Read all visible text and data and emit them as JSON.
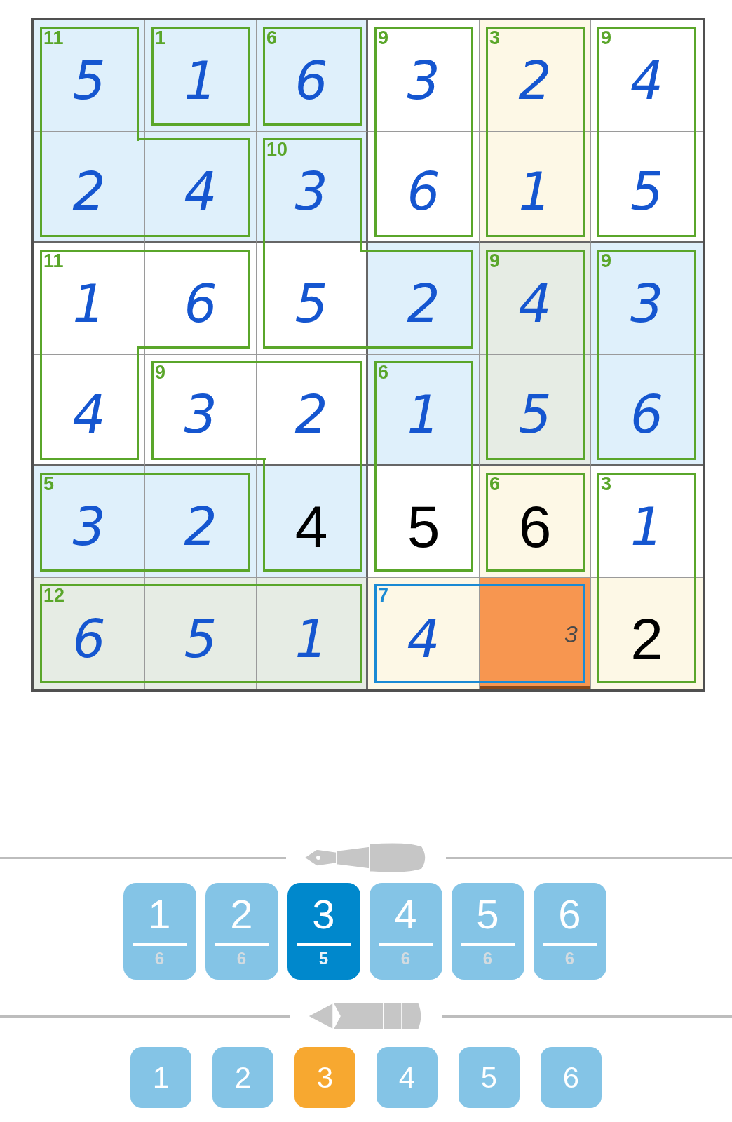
{
  "grid": {
    "rows": [
      [
        {
          "value": "5",
          "given": false,
          "selected": false,
          "color": "#dff0fb",
          "cage_sum": "11",
          "cage_selected": false,
          "joined_right": false,
          "joined_down": true
        },
        {
          "value": "1",
          "given": false,
          "selected": false,
          "color": "#dff0fb",
          "cage_sum": "1",
          "cage_selected": false,
          "joined_right": false,
          "joined_down": false
        },
        {
          "value": "6",
          "given": false,
          "selected": false,
          "color": "#dff0fb",
          "cage_sum": "6",
          "cage_selected": false,
          "joined_right": false,
          "joined_down": false
        },
        {
          "value": "3",
          "given": false,
          "selected": false,
          "color": "#ffffff",
          "cage_sum": "9",
          "cage_selected": false,
          "joined_right": false,
          "joined_down": true
        },
        {
          "value": "2",
          "given": false,
          "selected": false,
          "color": "#fdf8e6",
          "cage_sum": "3",
          "cage_selected": false,
          "joined_right": false,
          "joined_down": true
        },
        {
          "value": "4",
          "given": false,
          "selected": false,
          "color": "#ffffff",
          "cage_sum": "9",
          "cage_selected": false,
          "joined_right": false,
          "joined_down": true
        }
      ],
      [
        {
          "value": "2",
          "given": false,
          "selected": false,
          "color": "#dff0fb",
          "cage_selected": false,
          "joined_right": true,
          "joined_down": false
        },
        {
          "value": "4",
          "given": false,
          "selected": false,
          "color": "#dff0fb",
          "cage_selected": false,
          "joined_right": false,
          "joined_down": false
        },
        {
          "value": "3",
          "given": false,
          "selected": false,
          "color": "#dff0fb",
          "cage_sum": "10",
          "cage_selected": false,
          "joined_right": false,
          "joined_down": true
        },
        {
          "value": "6",
          "given": false,
          "selected": false,
          "color": "#ffffff",
          "cage_selected": false,
          "joined_right": false,
          "joined_down": false
        },
        {
          "value": "1",
          "given": false,
          "selected": false,
          "color": "#fdf8e6",
          "cage_selected": false,
          "joined_right": false,
          "joined_down": false
        },
        {
          "value": "5",
          "given": false,
          "selected": false,
          "color": "#ffffff",
          "cage_selected": false,
          "joined_right": false,
          "joined_down": false
        }
      ],
      [
        {
          "value": "1",
          "given": false,
          "selected": false,
          "color": "#ffffff",
          "cage_sum": "11",
          "cage_selected": false,
          "joined_right": true,
          "joined_down": true
        },
        {
          "value": "6",
          "given": false,
          "selected": false,
          "color": "#ffffff",
          "cage_selected": false,
          "joined_right": false,
          "joined_down": false
        },
        {
          "value": "5",
          "given": false,
          "selected": false,
          "color": "#ffffff",
          "cage_selected": false,
          "joined_right": true,
          "joined_down": false
        },
        {
          "value": "2",
          "given": false,
          "selected": false,
          "color": "#dff0fb",
          "cage_selected": false,
          "joined_right": false,
          "joined_down": false
        },
        {
          "value": "4",
          "given": false,
          "selected": false,
          "color": "#e6ece4",
          "cage_sum": "9",
          "cage_selected": false,
          "joined_right": false,
          "joined_down": true
        },
        {
          "value": "3",
          "given": false,
          "selected": false,
          "color": "#dff0fb",
          "cage_sum": "9",
          "cage_selected": false,
          "joined_right": false,
          "joined_down": true
        }
      ],
      [
        {
          "value": "4",
          "given": false,
          "selected": false,
          "color": "#ffffff",
          "cage_selected": false,
          "joined_right": false,
          "joined_down": false
        },
        {
          "value": "3",
          "given": false,
          "selected": false,
          "color": "#ffffff",
          "cage_sum": "9",
          "cage_selected": false,
          "joined_right": true,
          "joined_down": false
        },
        {
          "value": "2",
          "given": false,
          "selected": false,
          "color": "#ffffff",
          "cage_selected": false,
          "joined_right": false,
          "joined_down": true
        },
        {
          "value": "1",
          "given": false,
          "selected": false,
          "color": "#dff0fb",
          "cage_sum": "6",
          "cage_selected": false,
          "joined_right": false,
          "joined_down": true
        },
        {
          "value": "5",
          "given": false,
          "selected": false,
          "color": "#e6ece4",
          "cage_selected": false,
          "joined_right": false,
          "joined_down": false
        },
        {
          "value": "6",
          "given": false,
          "selected": false,
          "color": "#dff0fb",
          "cage_selected": false,
          "joined_right": false,
          "joined_down": false
        }
      ],
      [
        {
          "value": "3",
          "given": false,
          "selected": false,
          "color": "#dff0fb",
          "cage_sum": "5",
          "cage_selected": false,
          "joined_right": true,
          "joined_down": false
        },
        {
          "value": "2",
          "given": false,
          "selected": false,
          "color": "#dff0fb",
          "cage_selected": false,
          "joined_right": false,
          "joined_down": false
        },
        {
          "value": "4",
          "given": true,
          "selected": false,
          "color": "#dff0fb",
          "cage_selected": false,
          "joined_right": false,
          "joined_down": false
        },
        {
          "value": "5",
          "given": true,
          "selected": false,
          "color": "#ffffff",
          "cage_selected": false,
          "joined_right": false,
          "joined_down": false
        },
        {
          "value": "6",
          "given": true,
          "selected": false,
          "color": "#fdf8e6",
          "cage_sum": "6",
          "cage_selected": false,
          "joined_right": false,
          "joined_down": false
        },
        {
          "value": "1",
          "given": false,
          "selected": false,
          "color": "#ffffff",
          "cage_sum": "3",
          "cage_selected": false,
          "joined_right": false,
          "joined_down": true
        }
      ],
      [
        {
          "value": "6",
          "given": false,
          "selected": false,
          "color": "#e6ece4",
          "cage_sum": "12",
          "cage_selected": false,
          "joined_right": true,
          "joined_down": false
        },
        {
          "value": "5",
          "given": false,
          "selected": false,
          "color": "#e6ece4",
          "cage_selected": false,
          "joined_right": true,
          "joined_down": false
        },
        {
          "value": "1",
          "given": false,
          "selected": false,
          "color": "#e6ece4",
          "cage_selected": false,
          "joined_right": false,
          "joined_down": false
        },
        {
          "value": "4",
          "given": false,
          "selected": false,
          "color": "#fdf8e6",
          "cage_sum": "7",
          "cage_selected": true,
          "joined_right": true,
          "joined_down": false
        },
        {
          "notes": [
            "3"
          ],
          "selected": true,
          "color": "#f79650",
          "cage_selected": true,
          "joined_right": false,
          "joined_down": false
        },
        {
          "value": "2",
          "given": true,
          "selected": false,
          "color": "#fdf8e6",
          "cage_selected": false,
          "joined_right": false,
          "joined_down": false
        }
      ]
    ]
  },
  "pen_buttons": [
    {
      "digit": "1",
      "count": "6",
      "selected": false
    },
    {
      "digit": "2",
      "count": "6",
      "selected": false
    },
    {
      "digit": "3",
      "count": "5",
      "selected": true
    },
    {
      "digit": "4",
      "count": "6",
      "selected": false
    },
    {
      "digit": "5",
      "count": "6",
      "selected": false
    },
    {
      "digit": "6",
      "count": "6",
      "selected": false
    }
  ],
  "pencil_buttons": [
    {
      "digit": "1",
      "selected": false
    },
    {
      "digit": "2",
      "selected": false
    },
    {
      "digit": "3",
      "selected": true
    },
    {
      "digit": "4",
      "selected": false
    },
    {
      "digit": "5",
      "selected": false
    },
    {
      "digit": "6",
      "selected": false
    }
  ]
}
